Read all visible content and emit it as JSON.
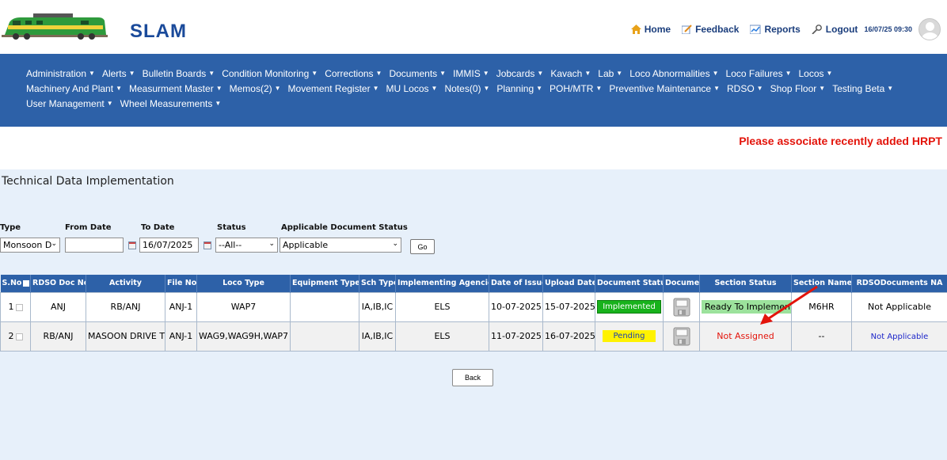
{
  "header": {
    "app_name": "SLAM",
    "links": [
      {
        "label": "Home",
        "icon": "home-icon"
      },
      {
        "label": "Feedback",
        "icon": "feedback-icon"
      },
      {
        "label": "Reports",
        "icon": "reports-icon"
      },
      {
        "label": "Logout",
        "icon": "logout-icon"
      }
    ],
    "datetime": "16/07/25 09:30"
  },
  "nav": {
    "rows": [
      [
        "Administration",
        "Alerts",
        "Bulletin Boards",
        "Condition Monitoring",
        "Corrections",
        "Documents",
        "IMMIS",
        "Jobcards",
        "Kavach",
        "Lab",
        "Loco Abnormalities",
        "Loco Failures",
        "Locos"
      ],
      [
        "Machinery And Plant",
        "Measurment Master",
        "Memos(2)",
        "Movement Register",
        "MU Locos",
        "Notes(0)",
        "Planning",
        "POH/MTR",
        "Preventive Maintenance",
        "RDSO",
        "Shop Floor",
        "Testing Beta"
      ],
      [
        "User Management",
        "Wheel Measurements"
      ]
    ]
  },
  "banner": {
    "message": "Please associate recently added HRPT"
  },
  "page": {
    "title": "Technical Data Implementation"
  },
  "filters": {
    "type_label": "Type",
    "type_value": "Monsoon D",
    "from_label": "From Date",
    "from_value": "",
    "to_label": "To Date",
    "to_value": "16/07/2025",
    "status_label": "Status",
    "status_value": "--All--",
    "doc_status_label": "Applicable Document Status",
    "doc_status_value": "Applicable",
    "go_label": "Go"
  },
  "table": {
    "headers": [
      "S.No",
      "RDSO Doc No.",
      "Activity",
      "File No.",
      "Loco Type",
      "Equipment Type",
      "Sch Type",
      "Implementing Agencies",
      "Date of Issue",
      "Upload Date",
      "Document Status",
      "Document",
      "Section Status",
      "Section Name",
      "RDSODocuments NA"
    ],
    "rows": [
      {
        "sno": "1",
        "doc_no": "ANJ",
        "activity": "RB/ANJ",
        "file_no": "ANJ-1",
        "loco_type": "WAP7",
        "equipment_type": "",
        "sch_type": "IA,IB,IC",
        "agencies": "ELS",
        "date_issue": "10-07-2025",
        "upload_date": "15-07-2025",
        "doc_status": "Implemented",
        "doc_status_color": "#18b21c",
        "section_status": "Ready To Implement",
        "section_name": "M6HR",
        "na": "Not Applicable"
      },
      {
        "sno": "2",
        "doc_no": "RB/ANJ",
        "activity": "MASOON DRIVE TEST",
        "file_no": "ANJ-1",
        "loco_type": "WAG9,WAG9H,WAP7",
        "equipment_type": "",
        "sch_type": "IA,IB,IC",
        "agencies": "ELS",
        "date_issue": "11-07-2025",
        "upload_date": "16-07-2025",
        "doc_status": "Pending",
        "doc_status_color": "#fff200",
        "section_status": "Not Assigned",
        "section_name": "--",
        "na": "Not Applicable"
      }
    ]
  },
  "back_label": "Back"
}
